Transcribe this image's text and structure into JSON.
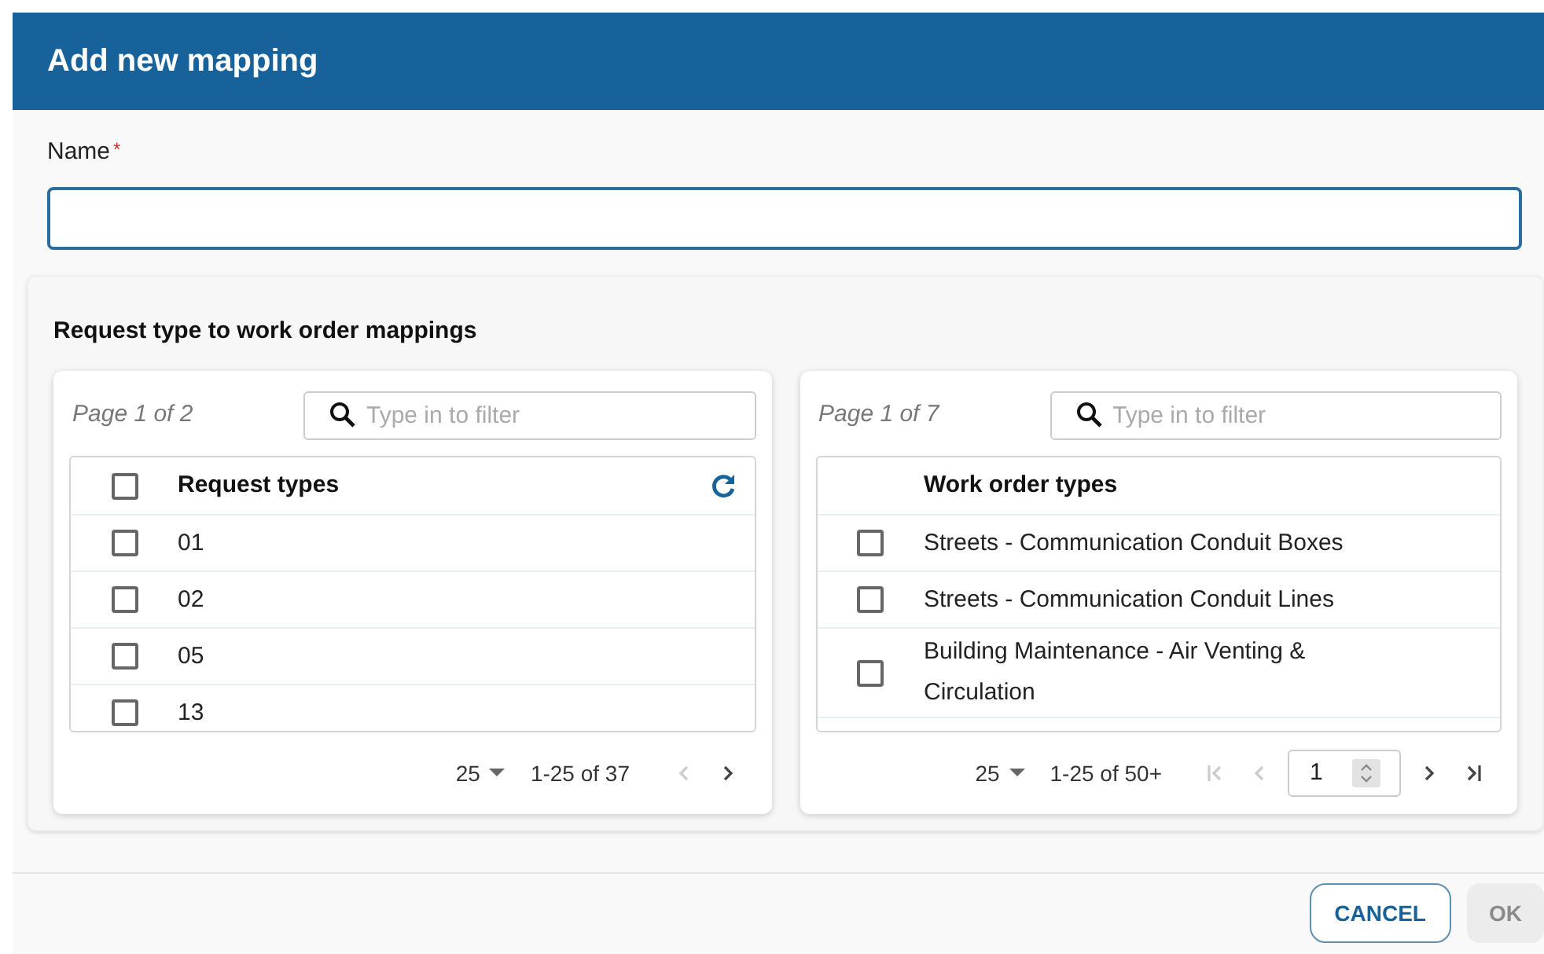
{
  "dialog": {
    "title": "Add new mapping"
  },
  "name_field": {
    "label": "Name",
    "required_mark": "*"
  },
  "section": {
    "title": "Request type to work order mappings"
  },
  "panels": [
    {
      "page_label": "Page 1 of 2",
      "filter": {
        "placeholder": "Type in to filter"
      },
      "header": {
        "kind": "selectable",
        "label": "Request types",
        "checked": false
      },
      "rows": [
        {
          "label": "01",
          "checked": false
        },
        {
          "label": "02",
          "checked": false
        },
        {
          "label": "05",
          "checked": false
        },
        {
          "label": "13",
          "checked": false
        }
      ],
      "pager": {
        "kind": "compact",
        "page_size": "25",
        "range": "1-25 of 37",
        "prev_disabled": true,
        "next_disabled": false
      }
    },
    {
      "page_label": "Page 1 of 7",
      "filter": {
        "placeholder": "Type in to filter"
      },
      "header": {
        "kind": "plain",
        "label": "Work order types"
      },
      "rows": [
        {
          "label": "Streets - Communication Conduit Boxes",
          "checked": false
        },
        {
          "label": "Streets - Communication Conduit Lines",
          "checked": false
        },
        {
          "label": "Building Maintenance - Air Venting & Circulation",
          "checked": false
        }
      ],
      "pager": {
        "kind": "full",
        "page_size": "25",
        "range": "1-25 of 50+",
        "page_input": "1",
        "prev_disabled": true,
        "next_disabled": false
      }
    }
  ],
  "buttons": [
    {
      "label": "CANCEL",
      "disabled": false
    },
    {
      "label": "OK",
      "disabled": true
    }
  ]
}
